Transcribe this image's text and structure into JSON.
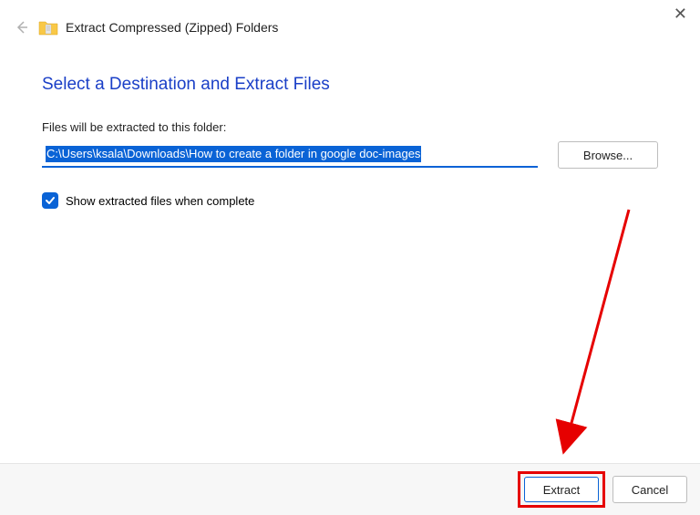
{
  "title": "Extract Compressed (Zipped) Folders",
  "heading": "Select a Destination and Extract Files",
  "path_label": "Files will be extracted to this folder:",
  "path_value": "C:\\Users\\ksala\\Downloads\\How to create a folder in google doc-images",
  "browse_label": "Browse...",
  "checkbox_label": "Show extracted files when complete",
  "extract_label": "Extract",
  "cancel_label": "Cancel"
}
